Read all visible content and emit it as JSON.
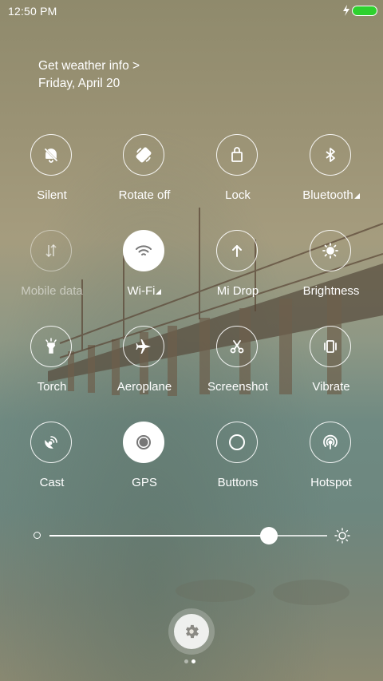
{
  "status_bar": {
    "time": "12:50 PM",
    "battery_color": "#2ed12e"
  },
  "header": {
    "weather_link": "Get weather info >",
    "date": "Friday, April 20"
  },
  "toggles": [
    {
      "label": "Silent",
      "icon": "silent-icon",
      "state": "off"
    },
    {
      "label": "Rotate off",
      "icon": "rotate-icon",
      "state": "off"
    },
    {
      "label": "Lock",
      "icon": "lock-icon",
      "state": "off"
    },
    {
      "label": "Bluetooth",
      "icon": "bluetooth-icon",
      "state": "off",
      "has_more": true
    },
    {
      "label": "Mobile data",
      "icon": "mobile-data-icon",
      "state": "disabled"
    },
    {
      "label": "Wi-Fi",
      "icon": "wifi-icon",
      "state": "on",
      "has_more": true
    },
    {
      "label": "Mi Drop",
      "icon": "mi-drop-icon",
      "state": "off"
    },
    {
      "label": "Brightness",
      "icon": "brightness-icon",
      "state": "off"
    },
    {
      "label": "Torch",
      "icon": "torch-icon",
      "state": "off"
    },
    {
      "label": "Aeroplane",
      "icon": "aeroplane-icon",
      "state": "off"
    },
    {
      "label": "Screenshot",
      "icon": "screenshot-icon",
      "state": "off"
    },
    {
      "label": "Vibrate",
      "icon": "vibrate-icon",
      "state": "off"
    },
    {
      "label": "Cast",
      "icon": "cast-icon",
      "state": "off"
    },
    {
      "label": "GPS",
      "icon": "gps-icon",
      "state": "on"
    },
    {
      "label": "Buttons",
      "icon": "buttons-icon",
      "state": "off"
    },
    {
      "label": "Hotspot",
      "icon": "hotspot-icon",
      "state": "off"
    }
  ],
  "brightness": {
    "level": 0.79
  },
  "pager": {
    "pages": 2,
    "current": 2
  }
}
